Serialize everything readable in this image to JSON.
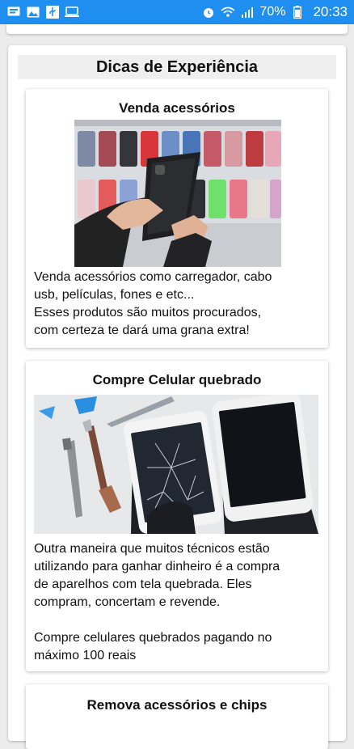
{
  "status_bar": {
    "battery": "70%",
    "time": "20:33"
  },
  "section_title": "Dicas de Experiência",
  "cards": [
    {
      "title": "Venda acessórios",
      "lines": [
        "Venda acessórios como carregador, cabo",
        "usb, películas, fones e etc...",
        "Esses produtos são muitos procurados,",
        "com certeza te dará uma grana extra!"
      ]
    },
    {
      "title": "Compre Celular quebrado",
      "lines": [
        "Outra maneira que muitos técnicos estão",
        "utilizando para ganhar dinheiro é a compra",
        "de aparelhos com tela quebrada. Eles",
        "compram, concertam e revende.",
        "",
        "Compre celulares quebrados pagando no",
        "máximo 100 reais"
      ]
    },
    {
      "title": "Remova acessórios e chips",
      "lines": []
    }
  ],
  "colors": {
    "status_bar": "#1e8ef0",
    "background": "#ececec"
  }
}
